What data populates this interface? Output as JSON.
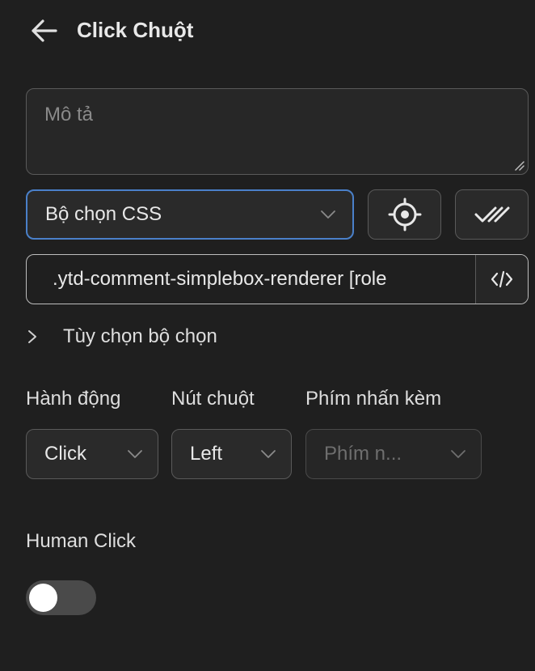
{
  "header": {
    "title": "Click Chuột"
  },
  "description": {
    "placeholder": "Mô tả"
  },
  "selector_type": {
    "value": "Bộ chọn CSS"
  },
  "selector": {
    "value": ".ytd-comment-simplebox-renderer [role"
  },
  "selector_options": {
    "label": "Tùy chọn bộ chọn"
  },
  "action": {
    "label": "Hành động",
    "value": "Click"
  },
  "mouse_button": {
    "label": "Nút chuột",
    "value": "Left"
  },
  "modifier_keys": {
    "label": "Phím nhấn kèm",
    "placeholder": "Phím n..."
  },
  "human_click": {
    "label": "Human Click",
    "enabled": false
  }
}
